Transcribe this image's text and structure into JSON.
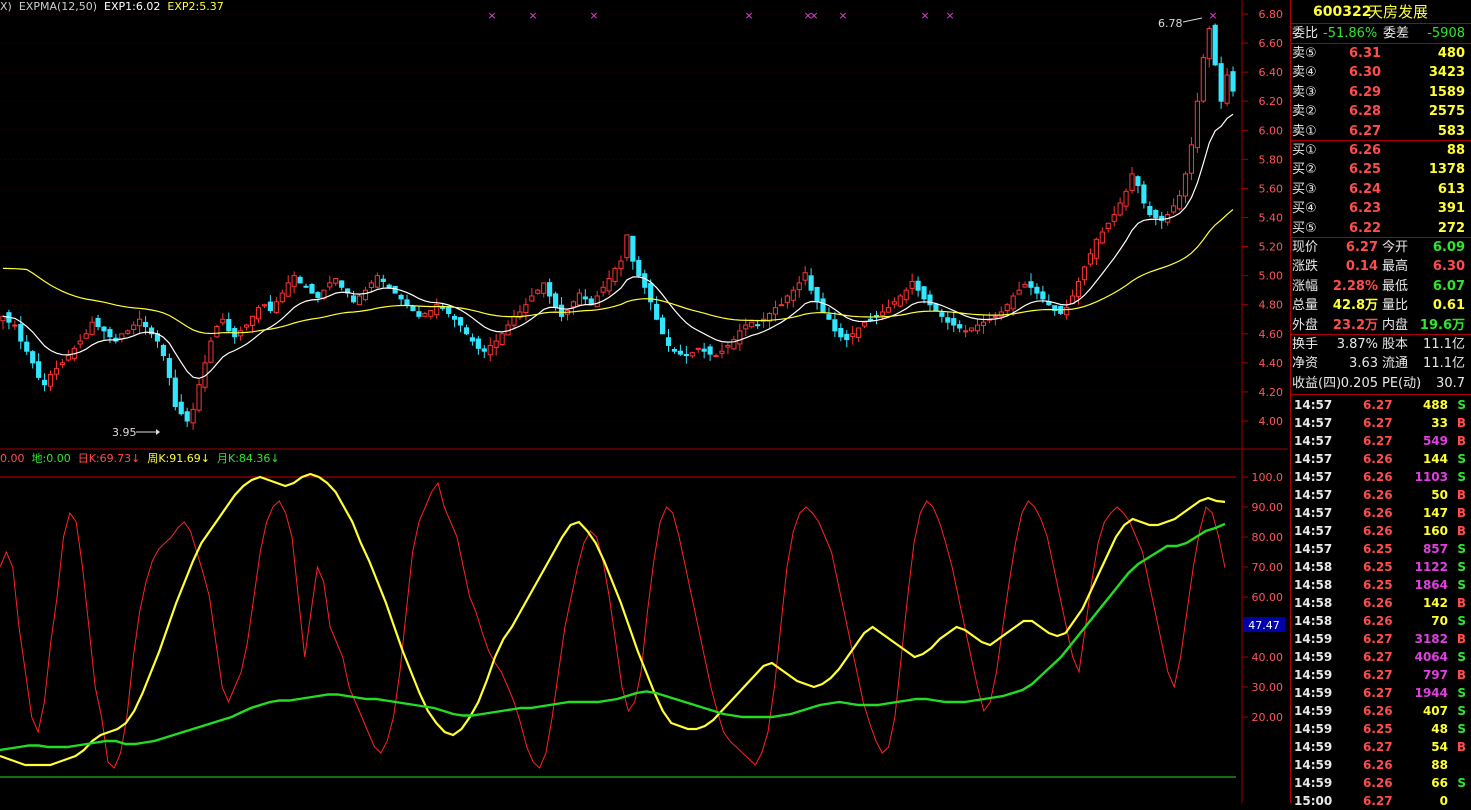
{
  "legend_top": {
    "items": [
      {
        "text": "X)",
        "color": "#cccccc"
      },
      {
        "text": "EXPMA(12,50)",
        "color": "#cccccc"
      },
      {
        "text": "EXP1:6.02",
        "color": "#ffffff"
      },
      {
        "text": "EXP2:5.37",
        "color": "#ffff33"
      }
    ]
  },
  "legend_bottom": {
    "items": [
      {
        "text": "0.00",
        "color": "#ff4d4d"
      },
      {
        "text": "地:0.00",
        "color": "#2ee62e"
      },
      {
        "text": "日K:69.73↓",
        "color": "#ff4d4d"
      },
      {
        "text": "周K:91.69↓",
        "color": "#ffff33"
      },
      {
        "text": "月K:84.36↓",
        "color": "#2ee62e"
      }
    ]
  },
  "colors": {
    "up": "#ff3333",
    "down": "#33e6ff",
    "exp1": "#ffffff",
    "exp2": "#ffff33",
    "grid": "#a00000",
    "axis_text": "#ff5555",
    "dayK": "#ff2222",
    "weekK": "#ffff33",
    "monthK": "#22dd22"
  },
  "chart_data": [
    {
      "type": "candlestick",
      "y_axis_ticks": [
        "6.80",
        "6.60",
        "6.40",
        "6.20",
        "6.00",
        "5.80",
        "5.60",
        "5.40",
        "5.20",
        "5.00",
        "4.80",
        "4.60",
        "4.40",
        "4.20",
        "4.00"
      ],
      "ylim": [
        3.9,
        6.85
      ],
      "annotations": [
        {
          "text": "6.78",
          "value": 6.78
        },
        {
          "text": "3.95",
          "value": 3.95
        }
      ],
      "marker_symbol": "×",
      "series": [
        {
          "name": "EXP1",
          "close_ends_at": 6.02
        },
        {
          "name": "EXP2",
          "close_ends_at": 5.37
        }
      ],
      "close": [
        4.72,
        4.68,
        4.66,
        4.55,
        4.48,
        4.4,
        4.3,
        4.25,
        4.32,
        4.36,
        4.4,
        4.45,
        4.5,
        4.55,
        4.6,
        4.68,
        4.65,
        4.62,
        4.58,
        4.55,
        4.6,
        4.62,
        4.66,
        4.7,
        4.65,
        4.6,
        4.55,
        4.45,
        4.3,
        4.1,
        4.05,
        4.0,
        4.08,
        4.25,
        4.4,
        4.55,
        4.65,
        4.7,
        4.62,
        4.58,
        4.62,
        4.66,
        4.72,
        4.78,
        4.8,
        4.76,
        4.82,
        4.88,
        4.95,
        5.0,
        4.95,
        4.92,
        4.88,
        4.85,
        4.9,
        4.95,
        4.98,
        4.92,
        4.88,
        4.82,
        4.86,
        4.9,
        4.95,
        5.0,
        4.96,
        4.92,
        4.88,
        4.84,
        4.8,
        4.76,
        4.72,
        4.74,
        4.76,
        4.8,
        4.78,
        4.74,
        4.7,
        4.66,
        4.6,
        4.55,
        4.5,
        4.48,
        4.52,
        4.55,
        4.6,
        4.66,
        4.72,
        4.75,
        4.8,
        4.86,
        4.9,
        4.95,
        4.86,
        4.78,
        4.72,
        4.76,
        4.82,
        4.88,
        4.84,
        4.8,
        4.86,
        4.92,
        4.98,
        5.05,
        5.1,
        5.28,
        5.1,
        5.0,
        4.92,
        4.82,
        4.7,
        4.6,
        4.52,
        4.48,
        4.46,
        4.45,
        4.47,
        4.5,
        4.48,
        4.46,
        4.45,
        4.48,
        4.52,
        4.56,
        4.62,
        4.66,
        4.68,
        4.66,
        4.7,
        4.74,
        4.78,
        4.8,
        4.86,
        4.9,
        4.95,
        5.02,
        4.9,
        4.82,
        4.75,
        4.7,
        4.62,
        4.58,
        4.56,
        4.6,
        4.64,
        4.68,
        4.7,
        4.72,
        4.75,
        4.78,
        4.82,
        4.86,
        4.9,
        4.96,
        4.9,
        4.84,
        4.8,
        4.76,
        4.72,
        4.68,
        4.66,
        4.64,
        4.62,
        4.64,
        4.66,
        4.68,
        4.7,
        4.72,
        4.75,
        4.8,
        4.86,
        4.9,
        4.94,
        4.92,
        4.88,
        4.84,
        4.8,
        4.76,
        4.74,
        4.78,
        4.86,
        4.96,
        5.06,
        5.15,
        5.25,
        5.3,
        5.36,
        5.42,
        5.5,
        5.58,
        5.7,
        5.62,
        5.5,
        5.42,
        5.4,
        5.38,
        5.42,
        5.48,
        5.55,
        5.7,
        5.9,
        6.2,
        6.5,
        6.7,
        6.45,
        6.2,
        6.38,
        6.27
      ],
      "expma_period": [
        12,
        50
      ]
    },
    {
      "type": "line",
      "y_axis_ticks": [
        "100.0",
        "90.00",
        "80.00",
        "70.00",
        "60.00",
        "50.00",
        "40.00",
        "30.00",
        "20.00"
      ],
      "ylim": [
        0,
        105
      ],
      "current_value_label": "47.47",
      "series": [
        {
          "name": "日K",
          "values": [
            70,
            75,
            70,
            50,
            35,
            20,
            15,
            25,
            45,
            60,
            80,
            88,
            85,
            70,
            50,
            30,
            20,
            5,
            3,
            8,
            20,
            40,
            55,
            65,
            72,
            76,
            78,
            80,
            83,
            85,
            82,
            75,
            68,
            60,
            45,
            30,
            25,
            30,
            35,
            45,
            60,
            75,
            85,
            90,
            92,
            88,
            80,
            60,
            40,
            55,
            70,
            65,
            50,
            45,
            40,
            30,
            25,
            20,
            15,
            10,
            8,
            12,
            20,
            35,
            55,
            75,
            85,
            90,
            95,
            98,
            90,
            85,
            80,
            70,
            60,
            55,
            48,
            42,
            38,
            35,
            30,
            25,
            18,
            10,
            5,
            3,
            8,
            20,
            35,
            50,
            60,
            70,
            78,
            82,
            80,
            72,
            60,
            45,
            30,
            22,
            25,
            35,
            55,
            72,
            85,
            90,
            88,
            80,
            70,
            60,
            50,
            40,
            30,
            22,
            15,
            12,
            10,
            8,
            6,
            4,
            8,
            15,
            30,
            50,
            70,
            82,
            88,
            90,
            88,
            85,
            80,
            75,
            65,
            55,
            45,
            35,
            25,
            18,
            12,
            8,
            10,
            20,
            40,
            60,
            78,
            88,
            92,
            90,
            85,
            78,
            70,
            60,
            50,
            40,
            30,
            22,
            25,
            35,
            50,
            65,
            78,
            88,
            92,
            90,
            86,
            80,
            70,
            60,
            50,
            40,
            35,
            50,
            65,
            78,
            85,
            88,
            90,
            88,
            85,
            80,
            75,
            65,
            55,
            45,
            35,
            30,
            40,
            55,
            70,
            82,
            90,
            88,
            80,
            69.73
          ]
        },
        {
          "name": "周K",
          "values": [
            7,
            6,
            5,
            4,
            4,
            4,
            4,
            5,
            6,
            7,
            9,
            12,
            14,
            15,
            16,
            18,
            22,
            28,
            35,
            42,
            50,
            58,
            65,
            72,
            78,
            82,
            86,
            90,
            94,
            97,
            99,
            100,
            99,
            98,
            97,
            98,
            100,
            101,
            100,
            98,
            95,
            90,
            85,
            78,
            72,
            65,
            58,
            50,
            42,
            35,
            28,
            22,
            18,
            15,
            14,
            16,
            20,
            25,
            32,
            40,
            46,
            50,
            55,
            60,
            65,
            70,
            75,
            80,
            84,
            85,
            82,
            78,
            72,
            65,
            58,
            50,
            42,
            35,
            28,
            22,
            18,
            17,
            16,
            16,
            17,
            19,
            22,
            25,
            28,
            31,
            34,
            37,
            38,
            36,
            34,
            32,
            31,
            30,
            31,
            33,
            36,
            40,
            44,
            48,
            50,
            48,
            46,
            44,
            42,
            40,
            41,
            43,
            46,
            48,
            50,
            49,
            47,
            45,
            44,
            46,
            48,
            50,
            52,
            52,
            50,
            48,
            47,
            48,
            52,
            56,
            62,
            68,
            74,
            80,
            84,
            86,
            85,
            84,
            84,
            85,
            86,
            88,
            90,
            92,
            93,
            92,
            91.69
          ]
        },
        {
          "name": "月K",
          "values": [
            9,
            9.5,
            10,
            10.5,
            10.5,
            10,
            10,
            10,
            10.5,
            11,
            11.5,
            12,
            12,
            11,
            11,
            11.5,
            12,
            13,
            14,
            15,
            16,
            17,
            18,
            19,
            20,
            21.5,
            23,
            24,
            25,
            25.5,
            25.5,
            26,
            26.5,
            27,
            27.5,
            27.5,
            27,
            26.5,
            26,
            26,
            25.5,
            25,
            24.5,
            24,
            23.5,
            23,
            22,
            21,
            20.5,
            20.5,
            21,
            21.5,
            22,
            22.5,
            23,
            23,
            23.5,
            24,
            24.5,
            25,
            25,
            25,
            25,
            25.5,
            26,
            27,
            28,
            28.5,
            28,
            27,
            26,
            25,
            24,
            23,
            22,
            21,
            20.5,
            20,
            20,
            20,
            20,
            20.5,
            21,
            22,
            23,
            24,
            24.5,
            25,
            24.5,
            24,
            24,
            24,
            24.5,
            25,
            25.5,
            26,
            26,
            25.5,
            25,
            25,
            25,
            25.5,
            26,
            26.5,
            27,
            28,
            29,
            31,
            34,
            37,
            40,
            44,
            48,
            52,
            56,
            60,
            64,
            68,
            71,
            73,
            75,
            77,
            77,
            78,
            80,
            82,
            83,
            84.36
          ]
        }
      ]
    }
  ],
  "stock": {
    "code": "600322",
    "name": "天房发展"
  },
  "weibi": {
    "label1": "委比",
    "val1": "-51.86%",
    "label2": "委差",
    "val2": "-5908"
  },
  "sell": [
    {
      "label": "卖⑤",
      "price": "6.31",
      "vol": "480"
    },
    {
      "label": "卖④",
      "price": "6.30",
      "vol": "3423"
    },
    {
      "label": "卖③",
      "price": "6.29",
      "vol": "1589"
    },
    {
      "label": "卖②",
      "price": "6.28",
      "vol": "2575"
    },
    {
      "label": "卖①",
      "price": "6.27",
      "vol": "583"
    }
  ],
  "buy": [
    {
      "label": "买①",
      "price": "6.26",
      "vol": "88"
    },
    {
      "label": "买②",
      "price": "6.25",
      "vol": "1378"
    },
    {
      "label": "买③",
      "price": "6.24",
      "vol": "613"
    },
    {
      "label": "买④",
      "price": "6.23",
      "vol": "391"
    },
    {
      "label": "买⑤",
      "price": "6.22",
      "vol": "272"
    }
  ],
  "quote": [
    {
      "l1": "现价",
      "v1": "6.27",
      "c1": "red",
      "l2": "今开",
      "v2": "6.09",
      "c2": "green"
    },
    {
      "l1": "涨跌",
      "v1": "0.14",
      "c1": "red",
      "l2": "最高",
      "v2": "6.30",
      "c2": "red"
    },
    {
      "l1": "涨幅",
      "v1": "2.28%",
      "c1": "red",
      "l2": "最低",
      "v2": "6.07",
      "c2": "green"
    },
    {
      "l1": "总量",
      "v1": "42.8万",
      "c1": "yellow",
      "l2": "量比",
      "v2": "0.61",
      "c2": "yellow"
    },
    {
      "l1": "外盘",
      "v1": "23.2万",
      "c1": "red",
      "l2": "内盘",
      "v2": "19.6万",
      "c2": "green"
    }
  ],
  "fund": [
    {
      "l1": "换手",
      "v1": "3.87%",
      "l2": "股本",
      "v2": "11.1亿"
    },
    {
      "l1": "净资",
      "v1": "3.63",
      "l2": "流通",
      "v2": "11.1亿"
    },
    {
      "l1": "收益(四)",
      "v1": "0.205",
      "l2": "PE(动)",
      "v2": "30.7"
    }
  ],
  "ticks": [
    {
      "time": "14:57",
      "price": "6.27",
      "pc": "red",
      "vol": "488",
      "vc": "yellow",
      "bs": "S"
    },
    {
      "time": "14:57",
      "price": "6.27",
      "pc": "red",
      "vol": "33",
      "vc": "yellow",
      "bs": "B"
    },
    {
      "time": "14:57",
      "price": "6.27",
      "pc": "red",
      "vol": "549",
      "vc": "magenta",
      "bs": "B"
    },
    {
      "time": "14:57",
      "price": "6.26",
      "pc": "red",
      "vol": "144",
      "vc": "yellow",
      "bs": "S"
    },
    {
      "time": "14:57",
      "price": "6.26",
      "pc": "red",
      "vol": "1103",
      "vc": "magenta",
      "bs": "S"
    },
    {
      "time": "14:57",
      "price": "6.26",
      "pc": "red",
      "vol": "50",
      "vc": "yellow",
      "bs": "B"
    },
    {
      "time": "14:57",
      "price": "6.26",
      "pc": "red",
      "vol": "147",
      "vc": "yellow",
      "bs": "B"
    },
    {
      "time": "14:57",
      "price": "6.26",
      "pc": "red",
      "vol": "160",
      "vc": "yellow",
      "bs": "B"
    },
    {
      "time": "14:57",
      "price": "6.25",
      "pc": "red",
      "vol": "857",
      "vc": "magenta",
      "bs": "S"
    },
    {
      "time": "14:58",
      "price": "6.25",
      "pc": "red",
      "vol": "1122",
      "vc": "magenta",
      "bs": "S"
    },
    {
      "time": "14:58",
      "price": "6.25",
      "pc": "red",
      "vol": "1864",
      "vc": "magenta",
      "bs": "S"
    },
    {
      "time": "14:58",
      "price": "6.26",
      "pc": "red",
      "vol": "142",
      "vc": "yellow",
      "bs": "B"
    },
    {
      "time": "14:58",
      "price": "6.26",
      "pc": "red",
      "vol": "70",
      "vc": "yellow",
      "bs": "S"
    },
    {
      "time": "14:59",
      "price": "6.27",
      "pc": "red",
      "vol": "3182",
      "vc": "magenta",
      "bs": "B"
    },
    {
      "time": "14:59",
      "price": "6.27",
      "pc": "red",
      "vol": "4064",
      "vc": "magenta",
      "bs": "S"
    },
    {
      "time": "14:59",
      "price": "6.27",
      "pc": "red",
      "vol": "797",
      "vc": "magenta",
      "bs": "B"
    },
    {
      "time": "14:59",
      "price": "6.27",
      "pc": "red",
      "vol": "1944",
      "vc": "magenta",
      "bs": "S"
    },
    {
      "time": "14:59",
      "price": "6.26",
      "pc": "red",
      "vol": "407",
      "vc": "yellow",
      "bs": "S"
    },
    {
      "time": "14:59",
      "price": "6.25",
      "pc": "red",
      "vol": "48",
      "vc": "yellow",
      "bs": "S"
    },
    {
      "time": "14:59",
      "price": "6.27",
      "pc": "red",
      "vol": "54",
      "vc": "yellow",
      "bs": "B"
    },
    {
      "time": "14:59",
      "price": "6.26",
      "pc": "red",
      "vol": "88",
      "vc": "yellow",
      "bs": ""
    },
    {
      "time": "14:59",
      "price": "6.26",
      "pc": "red",
      "vol": "66",
      "vc": "yellow",
      "bs": "S"
    },
    {
      "time": "15:00",
      "price": "6.27",
      "pc": "red",
      "vol": "0",
      "vc": "yellow",
      "bs": ""
    }
  ]
}
